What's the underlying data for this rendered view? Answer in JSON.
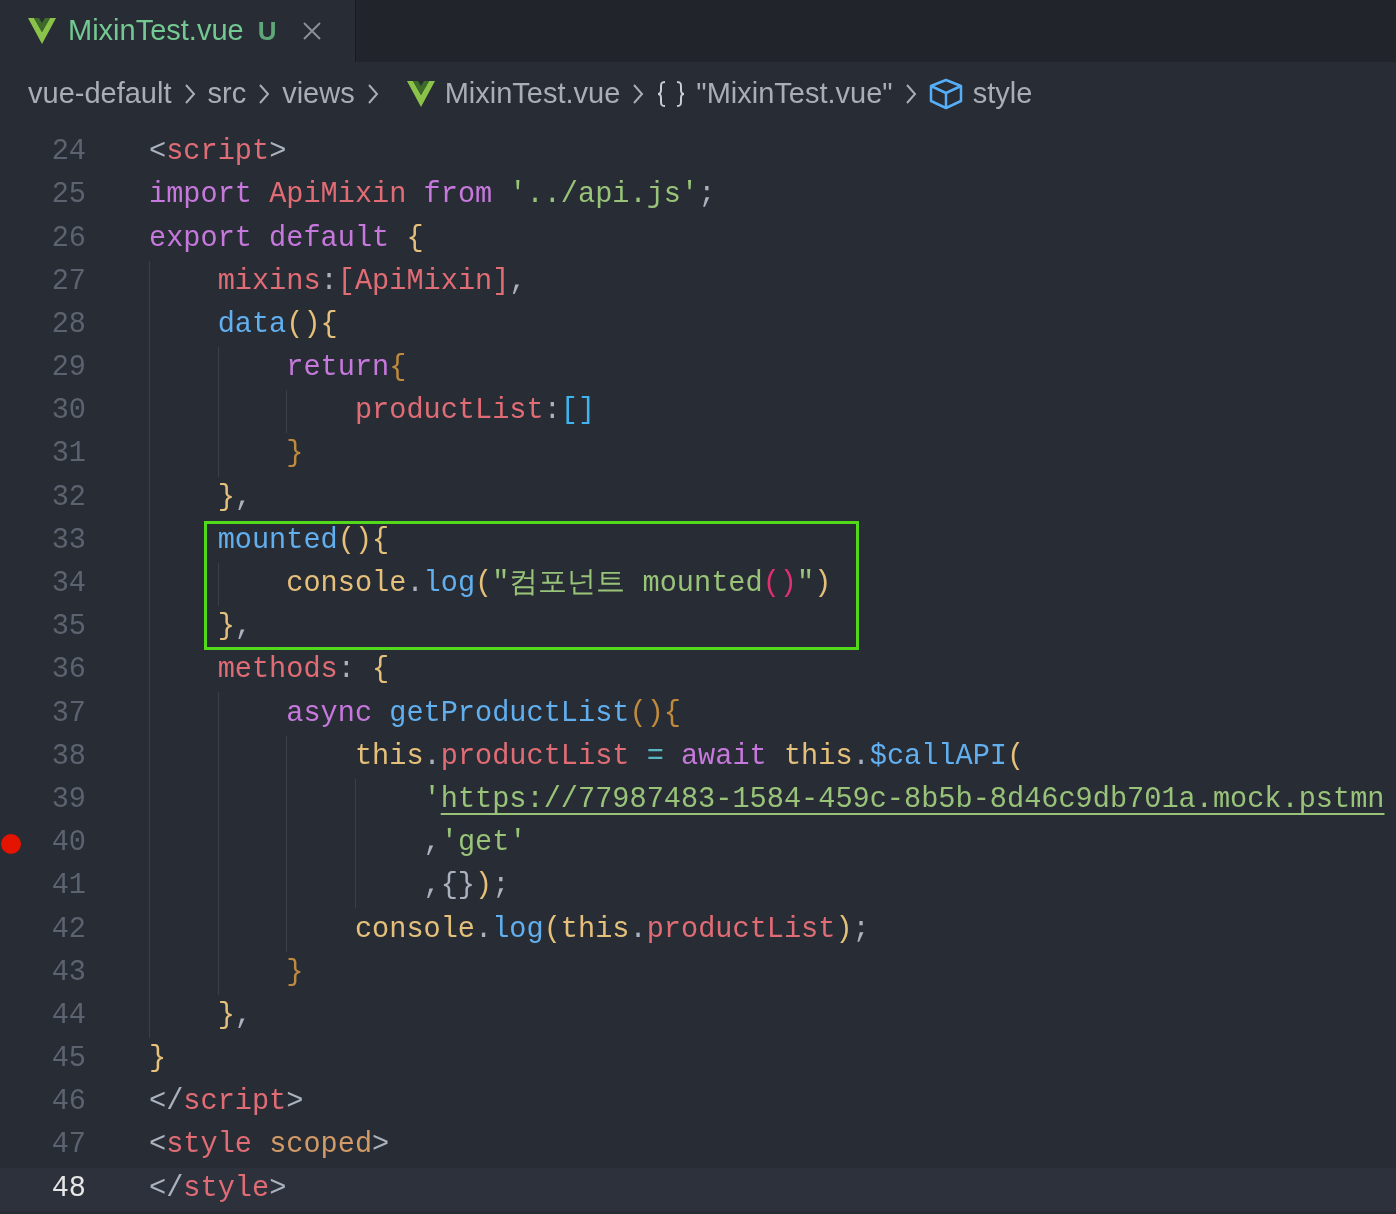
{
  "tabs": [
    {
      "label": "MixinTest.vue",
      "status": "U",
      "selected": true,
      "kind": "vue"
    }
  ],
  "breadcrumb": [
    {
      "label": "vue-default",
      "kind": "folder"
    },
    {
      "label": "src",
      "kind": "folder"
    },
    {
      "label": "views",
      "kind": "folder"
    },
    {
      "label": "MixinTest.vue",
      "kind": "vue"
    },
    {
      "label": "\"MixinTest.vue\"",
      "kind": "object"
    },
    {
      "label": "style",
      "kind": "element"
    }
  ],
  "lines": [
    {
      "number": "24",
      "breakpoint": false,
      "current": false,
      "boxed": false,
      "tokens": [
        {
          "text": "<",
          "kind": "punct"
        },
        {
          "text": "script",
          "kind": "tag"
        },
        {
          "text": ">",
          "kind": "punct"
        }
      ]
    },
    {
      "number": "25",
      "breakpoint": false,
      "current": false,
      "boxed": false,
      "tokens": [
        {
          "text": "import",
          "kind": "keyword"
        },
        {
          "text": " ApiMixin ",
          "kind": "variable"
        },
        {
          "text": "from",
          "kind": "keyword"
        },
        {
          "text": " '../api.js'",
          "kind": "string"
        },
        {
          "text": ";",
          "kind": "punct"
        }
      ]
    },
    {
      "number": "26",
      "breakpoint": false,
      "current": false,
      "boxed": false,
      "tokens": [
        {
          "text": "export default ",
          "kind": "keyword"
        },
        {
          "text": "{",
          "kind": "bracket1"
        }
      ]
    },
    {
      "number": "27",
      "breakpoint": false,
      "current": false,
      "boxed": false,
      "tokens": [
        {
          "text": "    mixins",
          "kind": "variable"
        },
        {
          "text": ":",
          "kind": "punct"
        },
        {
          "text": "[ApiMixin]",
          "kind": "variable"
        },
        {
          "text": ",",
          "kind": "punct"
        }
      ]
    },
    {
      "number": "28",
      "breakpoint": false,
      "current": false,
      "boxed": false,
      "tokens": [
        {
          "text": "    data",
          "kind": "function"
        },
        {
          "text": "(){",
          "kind": "bracket1"
        }
      ]
    },
    {
      "number": "29",
      "breakpoint": false,
      "current": false,
      "boxed": false,
      "tokens": [
        {
          "text": "        return",
          "kind": "keyword"
        },
        {
          "text": "{",
          "kind": "bracket2"
        }
      ]
    },
    {
      "number": "30",
      "breakpoint": false,
      "current": false,
      "boxed": false,
      "tokens": [
        {
          "text": "            productList",
          "kind": "variable"
        },
        {
          "text": ":",
          "kind": "punct"
        },
        {
          "text": "[]",
          "kind": "bracket3"
        }
      ]
    },
    {
      "number": "31",
      "breakpoint": false,
      "current": false,
      "boxed": false,
      "tokens": [
        {
          "text": "        }",
          "kind": "bracket2"
        }
      ]
    },
    {
      "number": "32",
      "breakpoint": false,
      "current": false,
      "boxed": false,
      "tokens": [
        {
          "text": "    }",
          "kind": "bracket1"
        },
        {
          "text": ",",
          "kind": "punct"
        }
      ]
    },
    {
      "number": "33",
      "breakpoint": false,
      "current": false,
      "boxed": true,
      "tokens": [
        {
          "text": "    mounted",
          "kind": "function"
        },
        {
          "text": "(){",
          "kind": "bracket1"
        }
      ]
    },
    {
      "number": "34",
      "breakpoint": false,
      "current": false,
      "boxed": true,
      "tokens": [
        {
          "text": "        console",
          "kind": "object"
        },
        {
          "text": ".",
          "kind": "punct"
        },
        {
          "text": "log",
          "kind": "function"
        },
        {
          "text": "(",
          "kind": "bracket1"
        },
        {
          "text": "\"컴포넌트 mounted",
          "kind": "string"
        },
        {
          "text": "()",
          "kind": "bracket4"
        },
        {
          "text": "\"",
          "kind": "string"
        },
        {
          "text": ")",
          "kind": "bracket1"
        }
      ]
    },
    {
      "number": "35",
      "breakpoint": false,
      "current": false,
      "boxed": true,
      "tokens": [
        {
          "text": "    }",
          "kind": "bracket1"
        },
        {
          "text": ",",
          "kind": "punct"
        }
      ]
    },
    {
      "number": "36",
      "breakpoint": false,
      "current": false,
      "boxed": false,
      "tokens": [
        {
          "text": "    methods",
          "kind": "variable"
        },
        {
          "text": ": ",
          "kind": "punct"
        },
        {
          "text": "{",
          "kind": "bracket1"
        }
      ]
    },
    {
      "number": "37",
      "breakpoint": false,
      "current": false,
      "boxed": false,
      "tokens": [
        {
          "text": "        async",
          "kind": "keyword"
        },
        {
          "text": " getProductList",
          "kind": "function"
        },
        {
          "text": "(){",
          "kind": "bracket2"
        }
      ]
    },
    {
      "number": "38",
      "breakpoint": false,
      "current": false,
      "boxed": false,
      "tokens": [
        {
          "text": "            this",
          "kind": "object"
        },
        {
          "text": ".",
          "kind": "punct"
        },
        {
          "text": "productList",
          "kind": "variable"
        },
        {
          "text": " = ",
          "kind": "operator"
        },
        {
          "text": "await",
          "kind": "keyword"
        },
        {
          "text": " this",
          "kind": "object"
        },
        {
          "text": ".",
          "kind": "punct"
        },
        {
          "text": "$callAPI",
          "kind": "function"
        },
        {
          "text": "(",
          "kind": "bracket1"
        }
      ]
    },
    {
      "number": "39",
      "breakpoint": false,
      "current": false,
      "boxed": false,
      "tokens": [
        {
          "text": "                '",
          "kind": "string"
        },
        {
          "text": "https://77987483-1584-459c-8b5b-8d46c9db701a.mock.pstmn",
          "kind": "link"
        }
      ]
    },
    {
      "number": "40",
      "breakpoint": true,
      "current": false,
      "boxed": false,
      "tokens": [
        {
          "text": "                ,",
          "kind": "punct"
        },
        {
          "text": "'get'",
          "kind": "string"
        }
      ]
    },
    {
      "number": "41",
      "breakpoint": false,
      "current": false,
      "boxed": false,
      "tokens": [
        {
          "text": "                ,{}",
          "kind": "punct"
        },
        {
          "text": ")",
          "kind": "bracket1"
        },
        {
          "text": ";",
          "kind": "punct"
        }
      ]
    },
    {
      "number": "42",
      "breakpoint": false,
      "current": false,
      "boxed": false,
      "tokens": [
        {
          "text": "            console",
          "kind": "object"
        },
        {
          "text": ".",
          "kind": "punct"
        },
        {
          "text": "log",
          "kind": "function"
        },
        {
          "text": "(",
          "kind": "bracket1"
        },
        {
          "text": "this",
          "kind": "object"
        },
        {
          "text": ".",
          "kind": "punct"
        },
        {
          "text": "productList",
          "kind": "variable"
        },
        {
          "text": ")",
          "kind": "bracket1"
        },
        {
          "text": ";",
          "kind": "punct"
        }
      ]
    },
    {
      "number": "43",
      "breakpoint": false,
      "current": false,
      "boxed": false,
      "tokens": [
        {
          "text": "        }",
          "kind": "bracket2"
        }
      ]
    },
    {
      "number": "44",
      "breakpoint": false,
      "current": false,
      "boxed": false,
      "tokens": [
        {
          "text": "    }",
          "kind": "bracket1"
        },
        {
          "text": ",",
          "kind": "punct"
        }
      ]
    },
    {
      "number": "45",
      "breakpoint": false,
      "current": false,
      "boxed": false,
      "tokens": [
        {
          "text": "}",
          "kind": "bracket1"
        }
      ]
    },
    {
      "number": "46",
      "breakpoint": false,
      "current": false,
      "boxed": false,
      "tokens": [
        {
          "text": "</",
          "kind": "punct"
        },
        {
          "text": "script",
          "kind": "tag"
        },
        {
          "text": ">",
          "kind": "punct"
        }
      ]
    },
    {
      "number": "47",
      "breakpoint": false,
      "current": false,
      "boxed": false,
      "tokens": [
        {
          "text": "<",
          "kind": "punct"
        },
        {
          "text": "style",
          "kind": "tag"
        },
        {
          "text": " scoped",
          "kind": "attribute"
        },
        {
          "text": ">",
          "kind": "punct"
        }
      ]
    },
    {
      "number": "48",
      "breakpoint": false,
      "current": true,
      "boxed": false,
      "tokens": [
        {
          "text": "</",
          "kind": "punct"
        },
        {
          "text": "style",
          "kind": "tag"
        },
        {
          "text": ">",
          "kind": "punct"
        }
      ]
    }
  ]
}
